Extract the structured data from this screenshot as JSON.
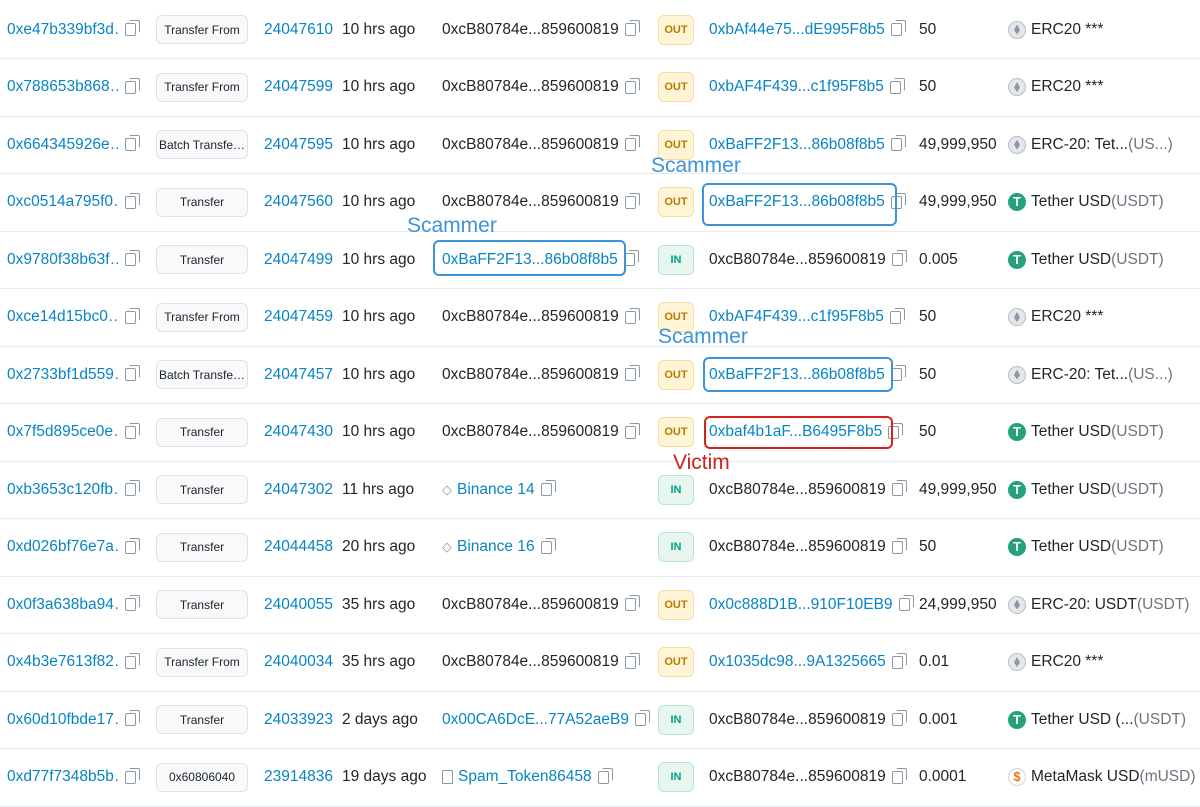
{
  "rows": [
    {
      "hash": "0xe47b339bf3d…",
      "method": "Transfer From",
      "block": "24047610",
      "age": "10 hrs ago",
      "from": {
        "text": "0xcB80784e...859600819",
        "kind": "plain"
      },
      "dir": "OUT",
      "to": {
        "text": "0xbAf44e75...dE995F8b5",
        "kind": "link"
      },
      "value": "50",
      "token": {
        "icon": "eth-icon",
        "name": "ERC20 ***",
        "suffix": ""
      }
    },
    {
      "hash": "0x788653b868…",
      "method": "Transfer From",
      "block": "24047599",
      "age": "10 hrs ago",
      "from": {
        "text": "0xcB80784e...859600819",
        "kind": "plain"
      },
      "dir": "OUT",
      "to": {
        "text": "0xbAF4F439...c1f95F8b5",
        "kind": "link"
      },
      "value": "50",
      "token": {
        "icon": "eth-icon",
        "name": "ERC20 ***",
        "suffix": ""
      }
    },
    {
      "hash": "0x664345926e…",
      "method": "Batch Transfe…",
      "block": "24047595",
      "age": "10 hrs ago",
      "from": {
        "text": "0xcB80784e...859600819",
        "kind": "plain"
      },
      "dir": "OUT",
      "to": {
        "text": "0xBaFF2F13...86b08f8b5",
        "kind": "link"
      },
      "value": "49,999,950",
      "token": {
        "icon": "eth-icon",
        "name": "ERC-20: Tet...",
        "suffix": " (US...)"
      }
    },
    {
      "hash": "0xc0514a795f0…",
      "method": "Transfer",
      "block": "24047560",
      "age": "10 hrs ago",
      "from": {
        "text": "0xcB80784e...859600819",
        "kind": "plain"
      },
      "dir": "OUT",
      "to": {
        "text": "0xBaFF2F13...86b08f8b5",
        "kind": "link"
      },
      "value": "49,999,950",
      "token": {
        "icon": "usdt-icon",
        "name": "Tether USD",
        "suffix": " (USDT)"
      }
    },
    {
      "hash": "0x9780f38b63f…",
      "method": "Transfer",
      "block": "24047499",
      "age": "10 hrs ago",
      "from": {
        "text": "0xBaFF2F13...86b08f8b5",
        "kind": "link"
      },
      "dir": "IN",
      "to": {
        "text": "0xcB80784e...859600819",
        "kind": "plain"
      },
      "value": "0.005",
      "token": {
        "icon": "usdt-icon",
        "name": "Tether USD",
        "suffix": " (USDT)"
      }
    },
    {
      "hash": "0xce14d15bc0…",
      "method": "Transfer From",
      "block": "24047459",
      "age": "10 hrs ago",
      "from": {
        "text": "0xcB80784e...859600819",
        "kind": "plain"
      },
      "dir": "OUT",
      "to": {
        "text": "0xbAF4F439...c1f95F8b5",
        "kind": "link"
      },
      "value": "50",
      "token": {
        "icon": "eth-icon",
        "name": "ERC20 ***",
        "suffix": ""
      }
    },
    {
      "hash": "0x2733bf1d559…",
      "method": "Batch Transfe…",
      "block": "24047457",
      "age": "10 hrs ago",
      "from": {
        "text": "0xcB80784e...859600819",
        "kind": "plain"
      },
      "dir": "OUT",
      "to": {
        "text": "0xBaFF2F13...86b08f8b5",
        "kind": "link"
      },
      "value": "50",
      "token": {
        "icon": "eth-icon",
        "name": "ERC-20: Tet...",
        "suffix": " (US...)"
      }
    },
    {
      "hash": "0x7f5d895ce0e…",
      "method": "Transfer",
      "block": "24047430",
      "age": "10 hrs ago",
      "from": {
        "text": "0xcB80784e...859600819",
        "kind": "plain"
      },
      "dir": "OUT",
      "to": {
        "text": "0xbaf4b1aF...B6495F8b5",
        "kind": "link"
      },
      "value": "50",
      "token": {
        "icon": "usdt-icon",
        "name": "Tether USD",
        "suffix": " (USDT)"
      }
    },
    {
      "hash": "0xb3653c120fb…",
      "method": "Transfer",
      "block": "24047302",
      "age": "11 hrs ago",
      "from": {
        "text": "Binance 14",
        "kind": "link",
        "prefix": "◇"
      },
      "dir": "IN",
      "to": {
        "text": "0xcB80784e...859600819",
        "kind": "plain"
      },
      "value": "49,999,950",
      "token": {
        "icon": "usdt-icon",
        "name": "Tether USD",
        "suffix": " (USDT)"
      }
    },
    {
      "hash": "0xd026bf76e7a…",
      "method": "Transfer",
      "block": "24044458",
      "age": "20 hrs ago",
      "from": {
        "text": "Binance 16",
        "kind": "link",
        "prefix": "◇"
      },
      "dir": "IN",
      "to": {
        "text": "0xcB80784e...859600819",
        "kind": "plain"
      },
      "value": "50",
      "token": {
        "icon": "usdt-icon",
        "name": "Tether USD",
        "suffix": " (USDT)"
      }
    },
    {
      "hash": "0x0f3a638ba94…",
      "method": "Transfer",
      "block": "24040055",
      "age": "35 hrs ago",
      "from": {
        "text": "0xcB80784e...859600819",
        "kind": "plain"
      },
      "dir": "OUT",
      "to": {
        "text": "0x0c888D1B...910F10EB9",
        "kind": "link"
      },
      "value": "24,999,950",
      "token": {
        "icon": "eth-icon",
        "name": "ERC-20: USDT",
        "suffix": " (USDT)"
      }
    },
    {
      "hash": "0x4b3e7613f82…",
      "method": "Transfer From",
      "block": "24040034",
      "age": "35 hrs ago",
      "from": {
        "text": "0xcB80784e...859600819",
        "kind": "plain"
      },
      "dir": "OUT",
      "to": {
        "text": "0x1035dc98...9A1325665",
        "kind": "link"
      },
      "value": "0.01",
      "token": {
        "icon": "eth-icon",
        "name": "ERC20 ***",
        "suffix": ""
      }
    },
    {
      "hash": "0x60d10fbde17…",
      "method": "Transfer",
      "block": "24033923",
      "age": "2 days ago",
      "from": {
        "text": "0x00CA6DcE...77A52aeB9",
        "kind": "link"
      },
      "dir": "IN",
      "to": {
        "text": "0xcB80784e...859600819",
        "kind": "plain"
      },
      "value": "0.001",
      "token": {
        "icon": "usdt-icon",
        "name": "Tether USD (...",
        "suffix": " (USDT)"
      }
    },
    {
      "hash": "0xd77f7348b5b…",
      "method": "0x60806040",
      "block": "23914836",
      "age": "19 days ago",
      "from": {
        "text": "Spam_Token86458",
        "kind": "link",
        "prefix": "doc"
      },
      "dir": "IN",
      "to": {
        "text": "0xcB80784e...859600819",
        "kind": "plain"
      },
      "value": "0.0001",
      "token": {
        "icon": "metamask-usd-icon",
        "name": "MetaMask USD",
        "suffix": " (mUSD)"
      }
    }
  ],
  "annotations": {
    "scammer_1": "Scammer",
    "scammer_2": "Scammer",
    "scammer_3": "Scammer",
    "victim": "Victim"
  },
  "colors": {
    "link": "#0784c3",
    "annotation_blue": "#3d93d9",
    "annotation_red": "#d2231f",
    "out_badge": "#b47d00",
    "in_badge": "#00a186"
  }
}
